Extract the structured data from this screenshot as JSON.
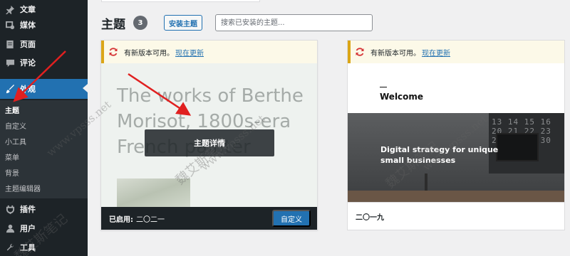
{
  "sidebar": {
    "items": [
      {
        "label": "文章",
        "icon": "pin-icon"
      },
      {
        "label": "媒体",
        "icon": "media-icon"
      },
      {
        "label": "页面",
        "icon": "page-icon"
      },
      {
        "label": "评论",
        "icon": "comment-icon"
      },
      {
        "label": "外观",
        "icon": "brush-icon",
        "active": true
      },
      {
        "label": "插件",
        "icon": "plugin-icon"
      },
      {
        "label": "用户",
        "icon": "user-icon"
      },
      {
        "label": "工具",
        "icon": "wrench-icon"
      }
    ],
    "submenu": [
      "主题",
      "自定义",
      "小工具",
      "菜单",
      "背景",
      "主题编辑器"
    ],
    "current_submenu": "主题"
  },
  "header": {
    "title": "主题",
    "count": "3",
    "install_label": "安装主题",
    "search_placeholder": "搜索已安装的主题..."
  },
  "themes": [
    {
      "notice_text": "有新版本可用。",
      "notice_link": "现在更新",
      "screenshot_headline": "The works of Berthe Morisot, 1800s-era French painter",
      "details_label": "主题详情",
      "active_label": "已启用:",
      "name": "二〇二一",
      "customize_label": "自定义"
    },
    {
      "notice_text": "有新版本可用。",
      "notice_link": "现在更新",
      "screenshot_welcome": "Welcome",
      "screenshot_tagline": "Digital strategy for unique small businesses",
      "screenshot_calendar": "13 14 15 16 20 21 22 23 27 28 29 30",
      "name": "二〇一九"
    }
  ],
  "watermark": [
    "魏艾斯笔记",
    "www.vpsss.net"
  ],
  "colors": {
    "sidebar_bg": "#1d2327",
    "accent": "#2271b1",
    "notice_border": "#dba617",
    "annotation": "#e02020"
  }
}
